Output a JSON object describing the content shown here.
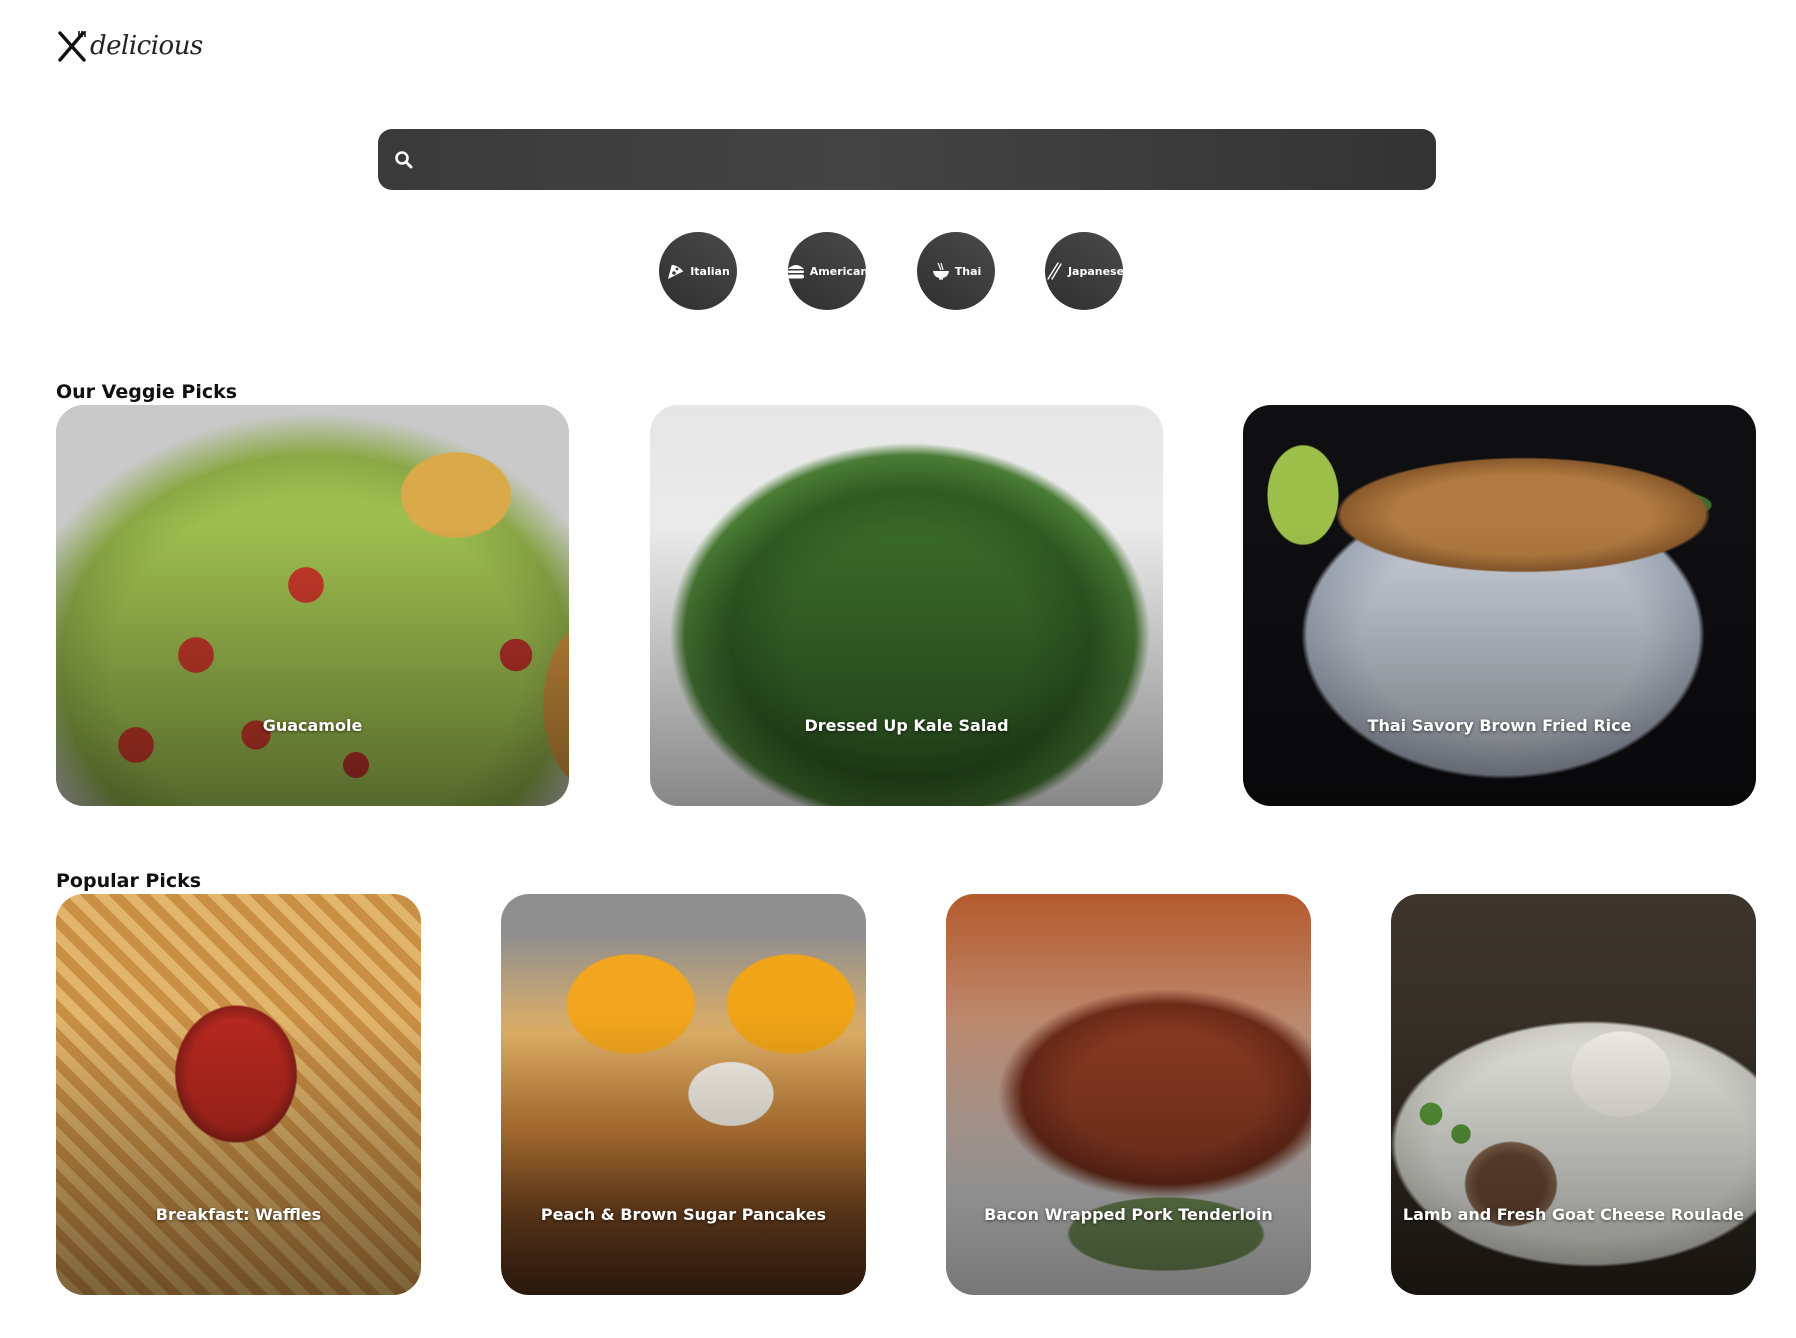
{
  "brand": {
    "logo_text": "delicious"
  },
  "search": {
    "placeholder": "",
    "value": ""
  },
  "cuisines": [
    {
      "label": "Italian",
      "icon": "pizza-icon"
    },
    {
      "label": "American",
      "icon": "burger-icon"
    },
    {
      "label": "Thai",
      "icon": "noodle-bowl-icon"
    },
    {
      "label": "Japanese",
      "icon": "chopsticks-icon"
    }
  ],
  "veggie": {
    "title": "Our Veggie Picks",
    "cards": [
      {
        "title": "Guacamole"
      },
      {
        "title": "Dressed Up Kale Salad"
      },
      {
        "title": "Thai Savory Brown Fried Rice"
      }
    ]
  },
  "popular": {
    "title": "Popular Picks",
    "cards": [
      {
        "title": "Breakfast: Waffles"
      },
      {
        "title": "Peach & Brown Sugar Pancakes"
      },
      {
        "title": "Bacon Wrapped Pork Tenderloin"
      },
      {
        "title": "Lamb and Fresh Goat Cheese Roulade"
      }
    ]
  },
  "colors": {
    "cuisine_bg": "#333333",
    "search_bg": "#3a3a3a",
    "card_text": "#ffffff"
  }
}
